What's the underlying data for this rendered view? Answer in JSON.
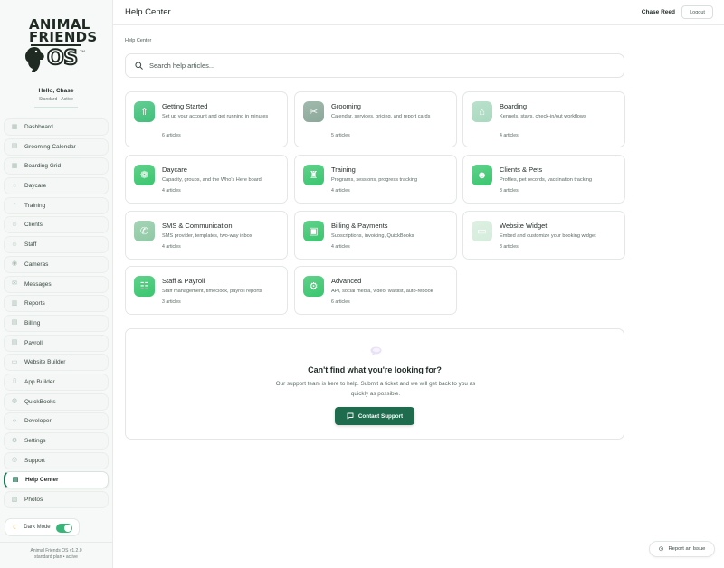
{
  "brand": {
    "line1": "ANIMAL",
    "line2": "FRIENDS",
    "os": "OS",
    "tm": "TM"
  },
  "user": {
    "greeting": "Hello, Chase",
    "plan": "Standard · Active",
    "name": "Chase Reed"
  },
  "topbar": {
    "title": "Help Center",
    "logout": "Logout"
  },
  "sidebar": {
    "items": [
      {
        "label": "Dashboard",
        "icon": "dashboard-icon"
      },
      {
        "label": "Grooming Calendar",
        "icon": "calendar-icon"
      },
      {
        "label": "Boarding Grid",
        "icon": "grid-icon"
      },
      {
        "label": "Daycare",
        "icon": "daycare-icon"
      },
      {
        "label": "Training",
        "icon": "training-icon"
      },
      {
        "label": "Clients",
        "icon": "clients-icon"
      },
      {
        "label": "Staff",
        "icon": "staff-icon"
      },
      {
        "label": "Cameras",
        "icon": "camera-icon"
      },
      {
        "label": "Messages",
        "icon": "message-icon"
      },
      {
        "label": "Reports",
        "icon": "reports-icon"
      },
      {
        "label": "Billing",
        "icon": "billing-icon"
      },
      {
        "label": "Payroll",
        "icon": "payroll-icon"
      },
      {
        "label": "Website Builder",
        "icon": "website-icon"
      },
      {
        "label": "App Builder",
        "icon": "phone-icon"
      },
      {
        "label": "QuickBooks",
        "icon": "quickbooks-icon"
      },
      {
        "label": "Developer",
        "icon": "code-icon"
      },
      {
        "label": "Settings",
        "icon": "settings-icon"
      },
      {
        "label": "Support",
        "icon": "support-icon"
      },
      {
        "label": "Help Center",
        "icon": "help-icon",
        "active": true
      },
      {
        "label": "Photos",
        "icon": "photos-icon"
      }
    ],
    "dark_mode_label": "Dark Mode",
    "dark_mode_on": true,
    "version_line1": "Animal Friends OS v1.2.0",
    "version_line2": "standard plan • active"
  },
  "main": {
    "breadcrumb": "Help Center",
    "search_placeholder": "Search help articles...",
    "categories": [
      {
        "title": "Getting Started",
        "desc": "Set up your account and get running in minutes",
        "count": "6 articles",
        "icon": "rocket-icon",
        "color": "#3fc079"
      },
      {
        "title": "Grooming",
        "desc": "Calendar, services, pricing, and report cards",
        "count": "5 articles",
        "icon": "scissors-icon",
        "color": "#8aa89a"
      },
      {
        "title": "Boarding",
        "desc": "Kennels, stays, check-in/out workflows",
        "count": "4 articles",
        "icon": "house-icon",
        "color": "#a9d9bf"
      },
      {
        "title": "Daycare",
        "desc": "Capacity, groups, and the Who's Here board",
        "count": "4 articles",
        "icon": "paw-icon",
        "color": "#39c66e"
      },
      {
        "title": "Training",
        "desc": "Programs, sessions, progress tracking",
        "count": "4 articles",
        "icon": "trophy-icon",
        "color": "#39c66e"
      },
      {
        "title": "Clients & Pets",
        "desc": "Profiles, pet records, vaccination tracking",
        "count": "3 articles",
        "icon": "people-icon",
        "color": "#39c66e"
      },
      {
        "title": "SMS & Communication",
        "desc": "SMS provider, templates, two-way inbox",
        "count": "4 articles",
        "icon": "phone-call-icon",
        "color": "#8fc9a4"
      },
      {
        "title": "Billing & Payments",
        "desc": "Subscriptions, invoicing, QuickBooks",
        "count": "4 articles",
        "icon": "wallet-icon",
        "color": "#39c66e"
      },
      {
        "title": "Website Widget",
        "desc": "Embed and customize your booking widget",
        "count": "3 articles",
        "icon": "window-icon",
        "color": "#d5ecdc"
      },
      {
        "title": "Staff & Payroll",
        "desc": "Staff management, timeclock, payroll reports",
        "count": "3 articles",
        "icon": "team-icon",
        "color": "#39c66e"
      },
      {
        "title": "Advanced",
        "desc": "API, social media, video, waitlist, auto-rebook",
        "count": "6 articles",
        "icon": "gear-icon",
        "color": "#39c66e"
      }
    ]
  },
  "support": {
    "title": "Can't find what you're looking for?",
    "desc": "Our support team is here to help. Submit a ticket and we will get back to you as quickly as possible.",
    "button": "Contact Support"
  },
  "report_issue": "Report an Issue"
}
